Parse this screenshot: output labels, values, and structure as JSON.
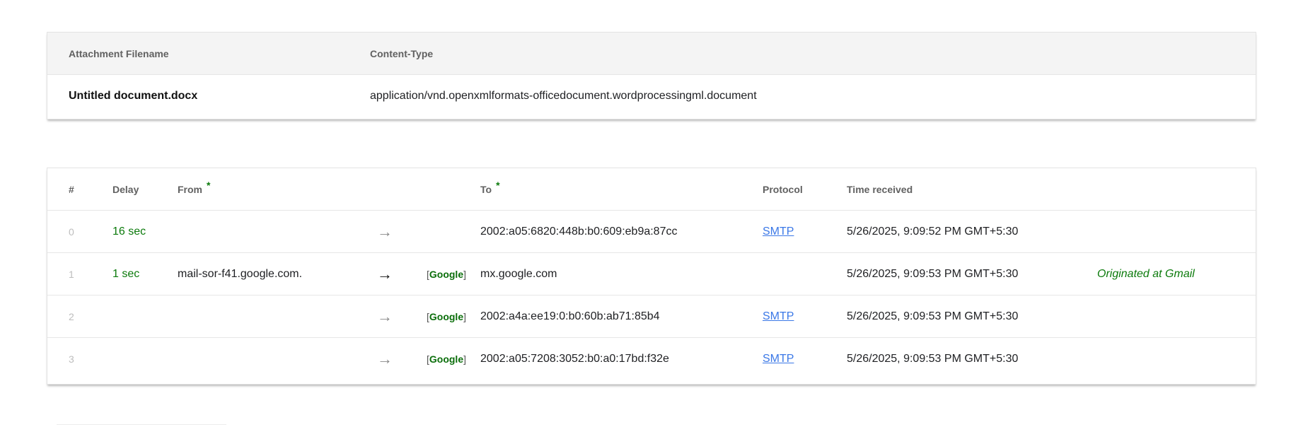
{
  "attachments": {
    "headers": {
      "filename": "Attachment Filename",
      "content_type": "Content-Type"
    },
    "rows": [
      {
        "filename": "Untitled document.docx",
        "content_type": "application/vnd.openxmlformats-officedocument.wordprocessingml.document"
      }
    ]
  },
  "hops": {
    "headers": {
      "num": "#",
      "delay": "Delay",
      "from": "From",
      "from_star": "*",
      "to": "To",
      "to_star": "*",
      "protocol": "Protocol",
      "time_received": "Time received"
    },
    "arrow_glyph": "→",
    "rows": [
      {
        "num": "0",
        "delay": "16 sec",
        "from": "",
        "tag_open": "",
        "tag_name": "",
        "tag_close": "",
        "to": "2002:a05:6820:448b:b0:609:eb9a:87cc",
        "protocol": "SMTP",
        "time": "5/26/2025, 9:09:52 PM GMT+5:30",
        "note": ""
      },
      {
        "num": "1",
        "delay": "1 sec",
        "from": "mail-sor-f41.google.com.",
        "tag_open": "[",
        "tag_name": "Google",
        "tag_close": "]",
        "to": "mx.google.com",
        "protocol": "",
        "time": "5/26/2025, 9:09:53 PM GMT+5:30",
        "note": "Originated at Gmail"
      },
      {
        "num": "2",
        "delay": "",
        "from": "",
        "tag_open": "[",
        "tag_name": "Google",
        "tag_close": "]",
        "to": "2002:a4a:ee19:0:b0:60b:ab71:85b4",
        "protocol": "SMTP",
        "time": "5/26/2025, 9:09:53 PM GMT+5:30",
        "note": ""
      },
      {
        "num": "3",
        "delay": "",
        "from": "",
        "tag_open": "[",
        "tag_name": "Google",
        "tag_close": "]",
        "to": "2002:a05:7208:3052:b0:a0:17bd:f32e",
        "protocol": "SMTP",
        "time": "5/26/2025, 9:09:53 PM GMT+5:30",
        "note": ""
      }
    ]
  }
}
